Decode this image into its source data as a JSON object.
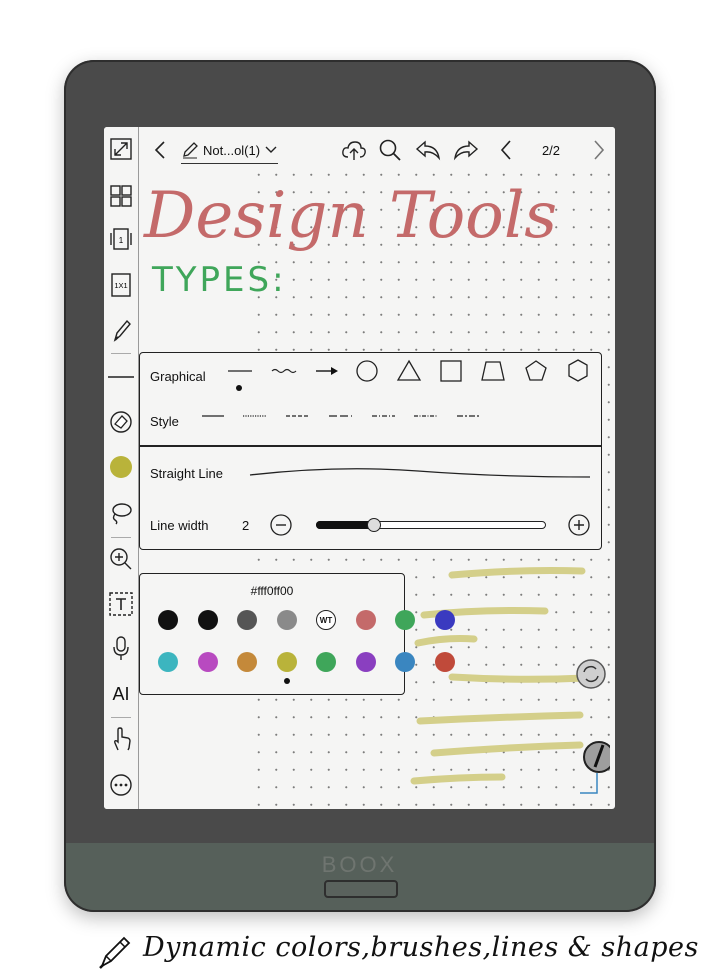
{
  "device": {
    "brand": "BOOX"
  },
  "topbar": {
    "doc_title": "Not...ol(1)",
    "page": "2/2"
  },
  "sidebar": {
    "icons": [
      "expand-icon",
      "grid-icon",
      "single-page-icon",
      "one-by-one-icon",
      "pen-icon",
      "line-icon",
      "eraser-icon",
      "color-dot-icon",
      "lasso-icon",
      "zoom-in-icon",
      "text-box-icon",
      "microphone-icon",
      "ai-icon",
      "hand-touch-icon",
      "more-icon"
    ],
    "ai_label": "AI",
    "page_label": "1X1",
    "single_label": "1"
  },
  "canvas": {
    "heading": "Design Tools",
    "subheading": "TYPES:",
    "heading_color": "#c46a6a",
    "subheading_color": "#3fa65a",
    "highlight_color": "#d4cf8a"
  },
  "shape_panel": {
    "graphical_label": "Graphical",
    "style_label": "Style",
    "line_type_label": "Straight Line",
    "line_width_label": "Line width",
    "line_width_value": "2",
    "line_width_fraction": 0.25,
    "shapes": [
      "line",
      "wavy-line",
      "arrow",
      "circle",
      "triangle",
      "square",
      "trapezoid",
      "pentagon",
      "hexagon"
    ]
  },
  "color_panel": {
    "hex": "#fff0ff00",
    "wt_label": "WT",
    "row1": [
      "#111111",
      "#111111",
      "#555555",
      "#8a8a8a",
      "WT",
      "#c46a6a",
      "#3fa65a",
      "#3a3ac0"
    ],
    "row2": [
      "#3cb5bf",
      "#b84ac0",
      "#c4893a",
      "#b9b33a",
      "#3fa65a",
      "#8a3fc0",
      "#3a86c0",
      "#c04a3a"
    ],
    "selected": "#b9b33a"
  },
  "caption": {
    "text": "Dynamic colors,brushes,lines & shapes"
  }
}
